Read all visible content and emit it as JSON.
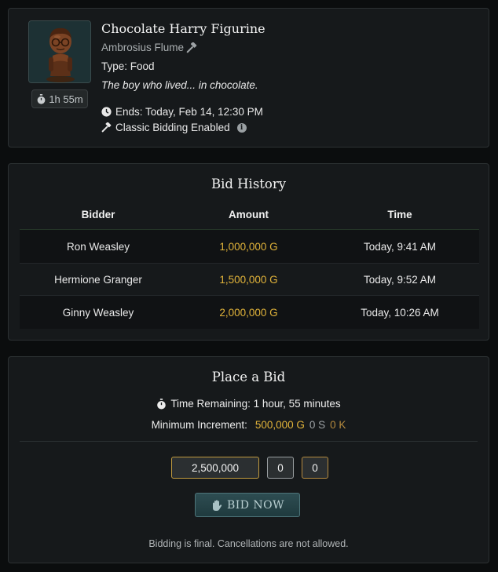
{
  "item": {
    "name": "Chocolate Harry Figurine",
    "creator": "Ambrosius Flume",
    "type": "Type: Food",
    "description": "The boy who lived... in chocolate.",
    "timer": "1h 55m",
    "ends": "Ends: Today, Feb 14, 12:30 PM",
    "bidding_mode": "Classic Bidding Enabled"
  },
  "history": {
    "title": "Bid History",
    "columns": [
      "Bidder",
      "Amount",
      "Time"
    ],
    "rows": [
      {
        "bidder": "Ron Weasley",
        "amount": "1,000,000 G",
        "time": "Today, 9:41 AM"
      },
      {
        "bidder": "Hermione Granger",
        "amount": "1,500,000 G",
        "time": "Today, 9:52 AM"
      },
      {
        "bidder": "Ginny Weasley",
        "amount": "2,000,000 G",
        "time": "Today, 10:26 AM"
      }
    ]
  },
  "bid": {
    "title": "Place a Bid",
    "time_remaining": "Time Remaining: 1 hour, 55 minutes",
    "min_increment_label": "Minimum Increment:",
    "min_increment_gold": "500,000 G",
    "min_increment_silver": "0 S",
    "min_increment_knut": "0 K",
    "gold_value": "2,500,000",
    "silver_value": "0",
    "knut_value": "0",
    "button_label": "BID NOW",
    "note": "Bidding is final. Cancellations are not allowed."
  },
  "colors": {
    "gold": "#e2b43a",
    "silver": "#9ea3a6",
    "knut": "#b58a3e",
    "button": "#2e4d52"
  },
  "icons": {
    "timer": "stopwatch-icon",
    "creator": "hammer-icon",
    "ends": "clock-icon",
    "classic": "gavel-icon",
    "info": "info-icon",
    "button": "hand-icon"
  }
}
